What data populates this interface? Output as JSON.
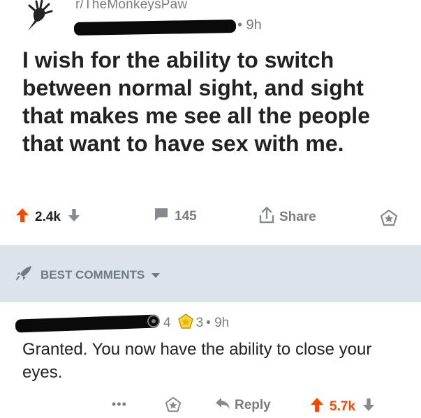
{
  "post": {
    "subreddit": "r/TheMonkeysPaw",
    "time": "• 9h",
    "title": "I wish for the ability to switch between normal sight, and sight that makes me see all the people that want to have sex with me.",
    "upvotes": "2.4k",
    "comments": "145",
    "share_label": "Share"
  },
  "comments_section": {
    "sort_label": "BEST COMMENTS"
  },
  "top_comment": {
    "award_a": "4",
    "award_b": "3",
    "time": "• 9h",
    "body": "Granted. You now have the ability to close your eyes.",
    "more": "•••",
    "reply_label": "Reply",
    "score": "5.7k"
  },
  "colors": {
    "upvote_accent": "#ff4500",
    "band_bg": "#dde3ea",
    "meta_text": "#7c7c7c",
    "award_gold": "#e7b800"
  },
  "icons": [
    "monkey-paw-icon",
    "upvote-icon",
    "downvote-icon",
    "comment-icon",
    "share-icon",
    "award-icon",
    "rocket-icon",
    "chevron-down-icon",
    "reply-icon"
  ]
}
